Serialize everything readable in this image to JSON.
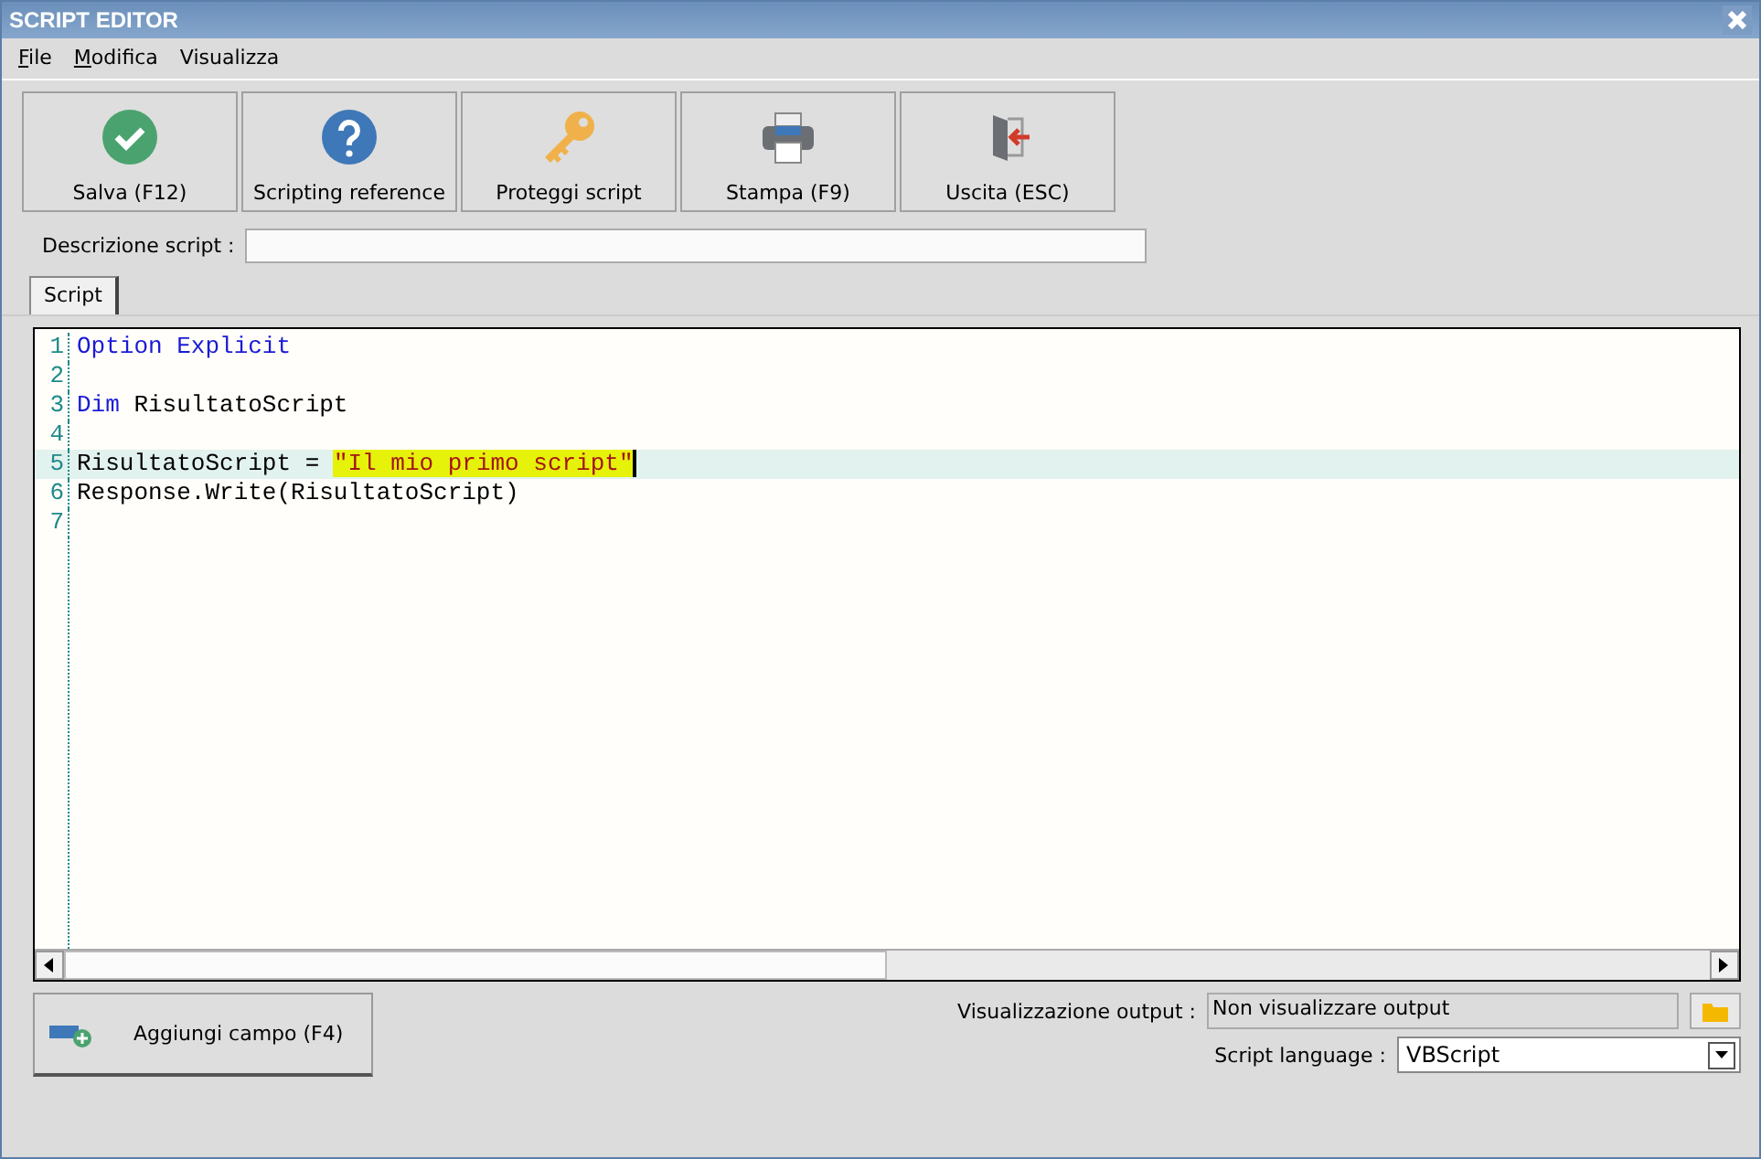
{
  "window": {
    "title": "SCRIPT EDITOR"
  },
  "menu": [
    {
      "label": "File",
      "underlined_initial": true
    },
    {
      "label": "Modifica",
      "underlined_initial": true
    },
    {
      "label": "Visualizza",
      "underlined_initial": false
    }
  ],
  "toolbar": [
    {
      "kind": "check",
      "label": "Salva (F12)"
    },
    {
      "kind": "help",
      "label": "Scripting reference"
    },
    {
      "kind": "key",
      "label": "Proteggi script"
    },
    {
      "kind": "printer",
      "label": "Stampa (F9)"
    },
    {
      "kind": "exit",
      "label": "Uscita (ESC)"
    }
  ],
  "description": {
    "label": "Descrizione script :"
  },
  "tabs": [
    {
      "label": "Script",
      "selected": true
    }
  ],
  "editor": {
    "lines": [
      {
        "number": "1",
        "current": false,
        "tokens": [
          {
            "kind": "keyword",
            "text": "Option Explicit",
            "highlighted": false
          }
        ]
      },
      {
        "number": "2",
        "current": false
      },
      {
        "number": "3",
        "current": false,
        "tokens": [
          {
            "kind": "keyword",
            "text": "Dim",
            "highlighted": false
          },
          {
            "kind": "plain",
            "text": " RisultatoScript",
            "highlighted": false
          }
        ]
      },
      {
        "number": "4",
        "current": false
      },
      {
        "number": "5",
        "current": true,
        "tokens": [
          {
            "kind": "plain",
            "text": "RisultatoScript = ",
            "highlighted": false
          },
          {
            "kind": "string",
            "text": "\"Il mio primo script\"",
            "highlighted": true
          }
        ]
      },
      {
        "number": "6",
        "current": false,
        "tokens": [
          {
            "kind": "plain",
            "text": "Response.Write(RisultatoScript)",
            "highlighted": false
          }
        ]
      },
      {
        "number": "7",
        "current": false
      }
    ]
  },
  "add_field_button": {
    "label": "Aggiungi campo (F4)"
  },
  "output": {
    "label": "Visualizzazione output :",
    "value": "Non visualizzare output"
  },
  "language": {
    "label": "Script language :",
    "value": "VBScript"
  }
}
